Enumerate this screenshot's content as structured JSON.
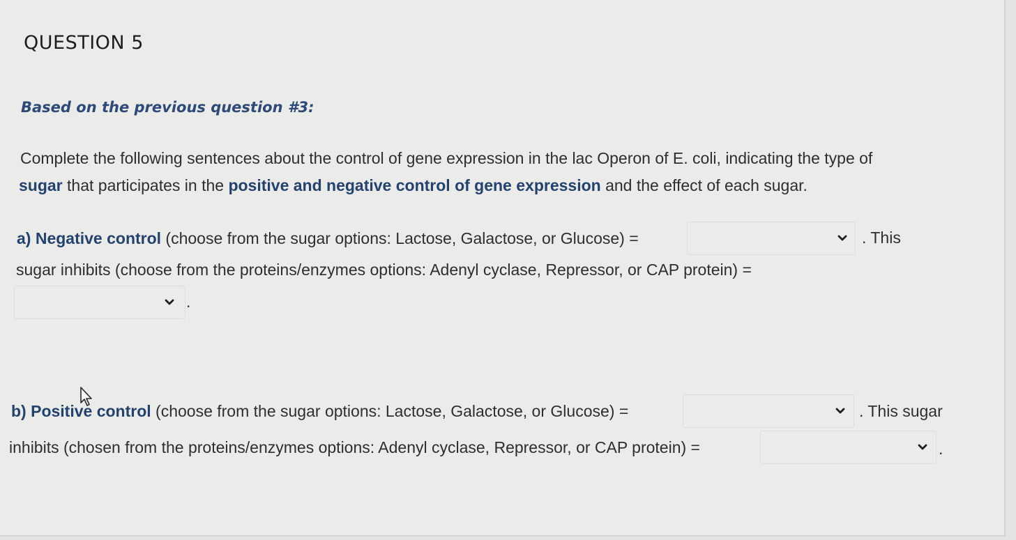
{
  "question": {
    "title": "QUESTION 5",
    "subtitle": "Based on the previous question #3:",
    "intro": {
      "l1": "Complete the following sentences about the control of gene expression in the lac Operon of E. coli, indicating the type of",
      "l2_b1": "sugar",
      "l2_t1": " that participates in the ",
      "l2_b2": "positive and negative control of gene expression",
      "l2_t2": " and the effect of each sugar."
    },
    "part_a": {
      "label": "a) Negative control",
      "l1_text": " (choose from the sugar options: Lactose, Galactose, or Glucose) =",
      "after_dd1": ". This",
      "l2": "sugar inhibits (choose from the proteins/enzymes options: Adenyl cyclase, Repressor, or CAP protein) =",
      "after_dd2": ".",
      "dropdown1_value": "",
      "dropdown2_value": ""
    },
    "part_b": {
      "label_pre": "b) Positive",
      "label_post": " control",
      "l1_text": " (choose from the sugar options: Lactose, Galactose, or Glucose) =",
      "after_dd1": ". This sugar",
      "l2": "inhibits (chosen from the proteins/enzymes options: Adenyl cyclase, Repressor, or CAP protein) =",
      "after_dd2": ".",
      "dropdown1_value": "",
      "dropdown2_value": ""
    }
  },
  "icons": {
    "dropdown": "chevron-down-icon",
    "pointer": "mouse-cursor-icon"
  },
  "colors": {
    "background": "#ebebea",
    "highlight": "#24426e",
    "subtitle": "#2d4a78",
    "text": "#2e2e2e"
  }
}
